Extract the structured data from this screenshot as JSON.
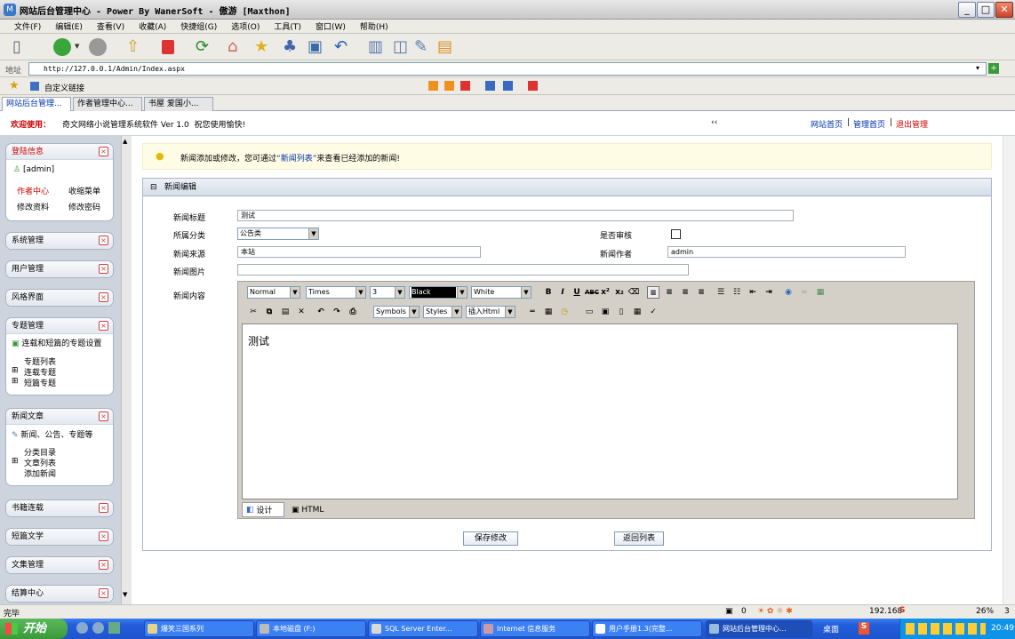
{
  "window": {
    "title": "网站后台管理中心 - Power By WanerSoft - 傲游 [Maxthon]"
  },
  "menu": [
    "文件(F)",
    "编辑(E)",
    "查看(V)",
    "收藏(A)",
    "快捷组(G)",
    "选项(O)",
    "工具(T)",
    "窗口(W)",
    "帮助(H)"
  ],
  "address": {
    "label": "地址",
    "url": "http://127.0.0.1/Admin/Index.aspx"
  },
  "favorites": {
    "label": "自定义链接"
  },
  "tabs": [
    "网站后台管理...",
    "作者管理中心...",
    "书屋 爱国小..."
  ],
  "welcome": {
    "label": "欢迎使用：",
    "text": "奇文网络小说管理系统软件 Ver 1.0  祝您使用愉快!",
    "collapse": "‹‹",
    "links": [
      "网站首页",
      "管理首页",
      "退出管理"
    ],
    "sep": "|"
  },
  "sidebar": {
    "login": {
      "title": "登陆信息",
      "user": "[admin]",
      "author_center": "作者中心",
      "collect_menu": "收缩菜单",
      "edit_profile": "修改资料",
      "change_password": "修改密码"
    },
    "system": "系统管理",
    "users": "用户管理",
    "style": "风格界面",
    "topics": {
      "title": "专题管理",
      "desc": "连载和短篇的专题设置",
      "items": [
        "专题列表",
        "连载专题",
        "短篇专题"
      ]
    },
    "news": {
      "title": "新闻文章",
      "desc": "新闻、公告、专题等",
      "items": [
        "分类目录",
        "文章列表",
        "添加新闻"
      ]
    },
    "books": "书籍连载",
    "short": "短篇文学",
    "anthology": "文集管理",
    "settle": "结算中心"
  },
  "tip": {
    "prefix": "新闻添加或修改，您可通过",
    "link": "新闻列表",
    "suffix": "来查看已经添加的新闻!"
  },
  "editor": {
    "header": "新闻编辑",
    "fields": {
      "title_label": "新闻标题",
      "title_value": "测试",
      "category_label": "所属分类",
      "category_value": "公告类",
      "review_label": "是否审核",
      "source_label": "新闻来源",
      "source_value": "本站",
      "author_label": "新闻作者",
      "author_value": "admin",
      "image_label": "新闻图片",
      "content_label": "新闻内容"
    },
    "toolbar1": {
      "format": "Normal",
      "font": "Times",
      "size": "3",
      "forecolor": "Black",
      "backcolor": "White"
    },
    "toolbar2": {
      "symbols": "Symbols",
      "styles": "Styles",
      "insert": "插入Html"
    },
    "content": "测试",
    "mode_design": "设计",
    "mode_html": "HTML",
    "save": "保存修改",
    "back": "返回列表"
  },
  "status": {
    "text": "完毕",
    "tray_count": "0",
    "ip": "192.168",
    "size": "26%",
    "num": "3"
  },
  "taskbar": {
    "start": "开始",
    "tasks": [
      "爆笑三国系列",
      "本地磁盘 (F:)",
      "SQL Server Enter...",
      "Internet 信息服务",
      "用户手册1.3(完整...",
      "网站后台管理中心..."
    ],
    "desktop": "桌面",
    "clock": "20:49"
  },
  "colors": {
    "accent_red": "#cc0000",
    "link_blue": "#0033aa",
    "sidebar_bg": "#cdd4de"
  }
}
